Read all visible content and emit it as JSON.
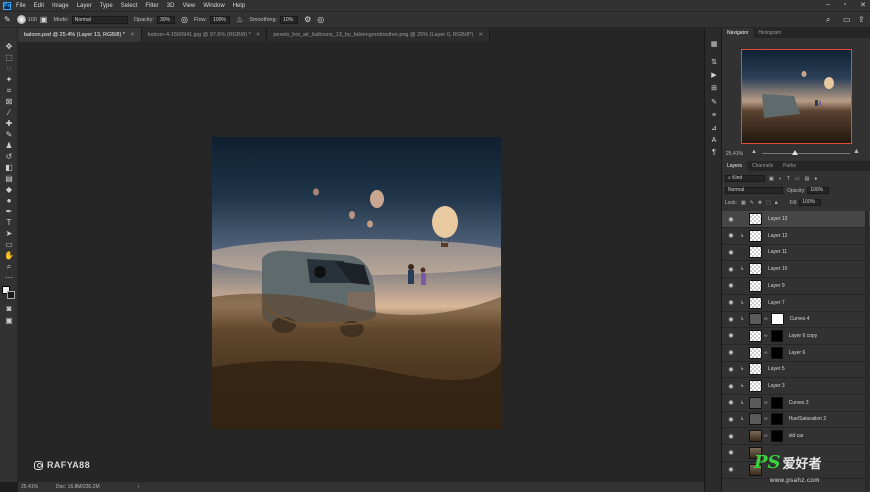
{
  "menu": [
    "File",
    "Edit",
    "Image",
    "Layer",
    "Type",
    "Select",
    "Filter",
    "3D",
    "View",
    "Window",
    "Help"
  ],
  "options": {
    "size": "100",
    "mode_label": "Mode:",
    "mode": "Normal",
    "opacity_label": "Opacity:",
    "opacity": "30%",
    "flow_label": "Flow:",
    "flow": "100%",
    "smoothing_label": "Smoothing:",
    "smoothing": "10%"
  },
  "tabs": [
    {
      "label": "baloon.psd @ 25.4% (Layer 13, RGB/8) *",
      "active": true
    },
    {
      "label": "baloon-4-1560941.jpg @ 97.6% (RGB/8) *",
      "active": false
    },
    {
      "label": "pexels_hot_air_balloons_13_by_fabiengoodmother.png @ 25% (Layer 0, RGB/8*)",
      "active": false
    }
  ],
  "status": {
    "zoom": "25.41%",
    "doc": "Doc: 16.8M/230.2M"
  },
  "watermark": "RAFYA88",
  "navigator": {
    "tab_active": "Navigator",
    "tab_other": "Histogram",
    "zoom": "25.41%"
  },
  "layers_panel": {
    "tabs": [
      "Layers",
      "Channels",
      "Paths"
    ],
    "filter": "Kind",
    "blend": "Normal",
    "opacity_label": "Opacity:",
    "opacity": "100%",
    "lock_label": "Lock:",
    "fill_label": "Fill:",
    "fill": "100%"
  },
  "layers": [
    {
      "name": "Layer 13",
      "clip": false,
      "thumb": "trans",
      "active": true
    },
    {
      "name": "Layer 12",
      "clip": true,
      "thumb": "trans",
      "active": false
    },
    {
      "name": "Layer 11",
      "clip": false,
      "thumb": "trans",
      "active": false
    },
    {
      "name": "Layer 10",
      "clip": true,
      "thumb": "trans",
      "active": false
    },
    {
      "name": "Layer 9",
      "clip": false,
      "thumb": "trans",
      "active": false
    },
    {
      "name": "Layer 7",
      "clip": true,
      "thumb": "trans",
      "active": false
    },
    {
      "name": "Curves 4",
      "clip": true,
      "thumb": "adj",
      "active": false
    },
    {
      "name": "Layer 6 copy",
      "clip": false,
      "thumb": "trans",
      "active": false
    },
    {
      "name": "Layer 6",
      "clip": false,
      "thumb": "trans",
      "active": false
    },
    {
      "name": "Layer 5",
      "clip": true,
      "thumb": "trans",
      "active": false
    },
    {
      "name": "Layer 3",
      "clip": true,
      "thumb": "trans",
      "active": false
    },
    {
      "name": "Curves 3",
      "clip": true,
      "thumb": "adj",
      "active": false
    },
    {
      "name": "Hue/Saturation 2",
      "clip": true,
      "thumb": "adj",
      "active": false
    },
    {
      "name": "old car",
      "clip": false,
      "thumb": "photo",
      "active": false
    },
    {
      "name": "",
      "clip": false,
      "thumb": "photo",
      "active": false
    },
    {
      "name": "",
      "clip": false,
      "thumb": "photo",
      "active": false
    }
  ],
  "brand": {
    "ps": "PS",
    "cn": "爱好者",
    "url": "www.psahz.com"
  },
  "colors": {
    "accent": "#31a8ff",
    "nav_frame": "#e04b3a",
    "brand_green": "#3cd23c"
  }
}
